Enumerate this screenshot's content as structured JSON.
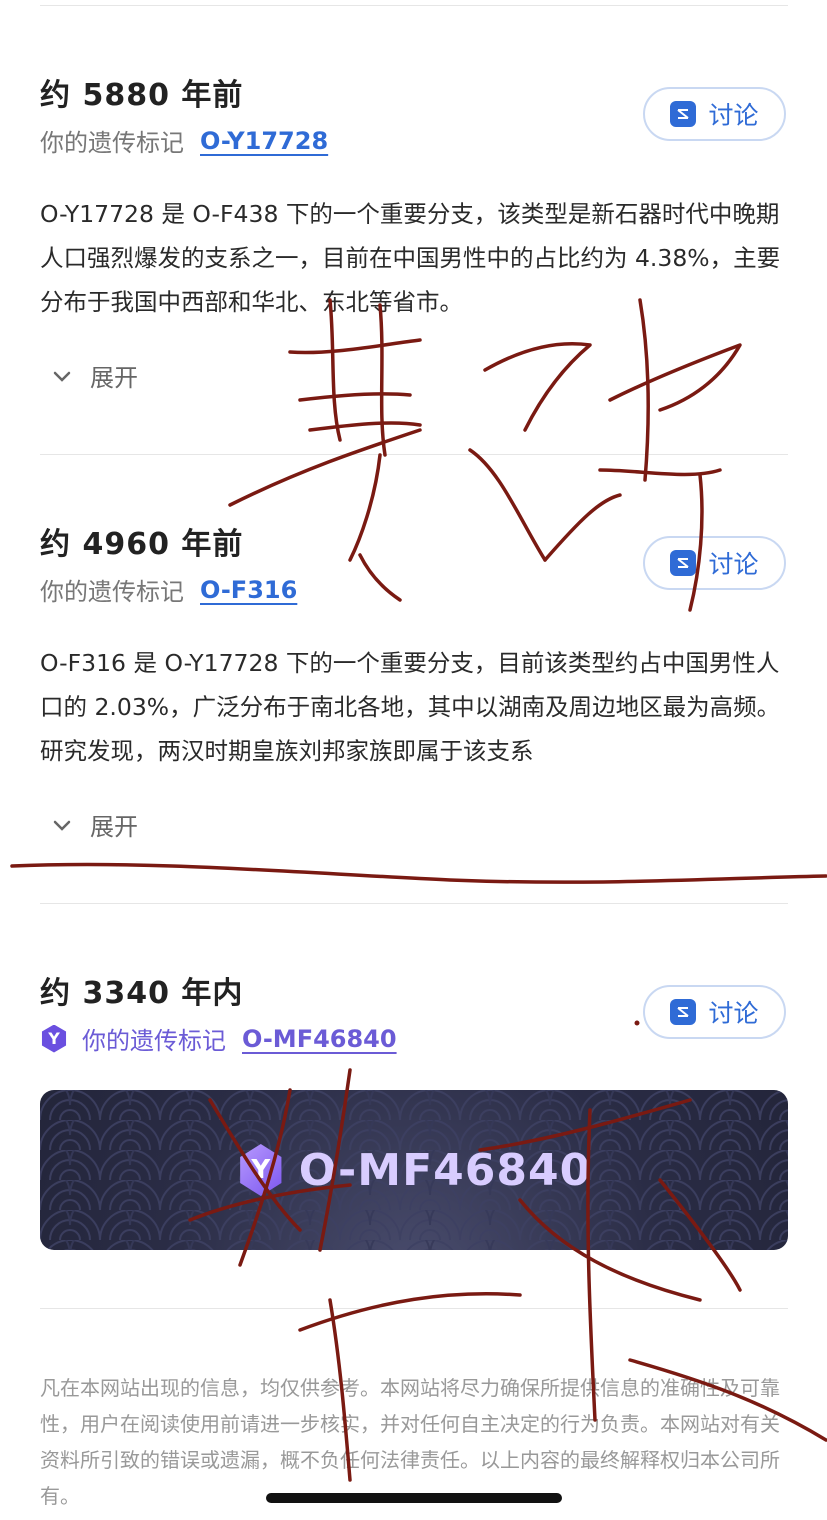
{
  "sections": [
    {
      "age": "约 5880 年前",
      "marker_label": "你的遗传标记",
      "marker_code": "O-Y17728",
      "discuss_label": "讨论",
      "description": "O-Y17728 是 O-F438 下的一个重要分支，该类型是新石器时代中晚期人口强烈爆发的支系之一，目前在中国男性中的占比约为 4.38%，主要分布于我国中西部和华北、东北等省市。",
      "expand_label": "展开"
    },
    {
      "age": "约 4960 年前",
      "marker_label": "你的遗传标记",
      "marker_code": "O-F316",
      "discuss_label": "讨论",
      "description": "O-F316 是 O-Y17728 下的一个重要分支，目前该类型约占中国男性人口的 2.03%，广泛分布于南北各地，其中以湖南及周边地区最为高频。研究发现，两汉时期皇族刘邦家族即属于该支系",
      "expand_label": "展开"
    },
    {
      "age": "约 3340 年内",
      "marker_label": "你的遗传标记",
      "marker_code": "O-MF46840",
      "badge_letter": "Y",
      "discuss_label": "讨论"
    }
  ],
  "banner": {
    "code": "O-MF46840",
    "badge_letter": "Y"
  },
  "disclaimer": "凡在本网站出现的信息，均仅供参考。本网站将尽力确保所提供信息的准确性及可靠性，用户在阅读使用前请进一步核实，并对任何自主决定的行为负责。本网站对有关资料所引致的错误或遗漏，概不负任何法律责任。以上内容的最终解释权归本公司所有。",
  "colors": {
    "accent_blue": "#2f6bd6",
    "accent_purple": "#6b5bd6",
    "scribble_red": "#7a1a12"
  },
  "icons": [
    "discuss-icon",
    "chevron-down-icon",
    "y-hexagon-icon"
  ]
}
